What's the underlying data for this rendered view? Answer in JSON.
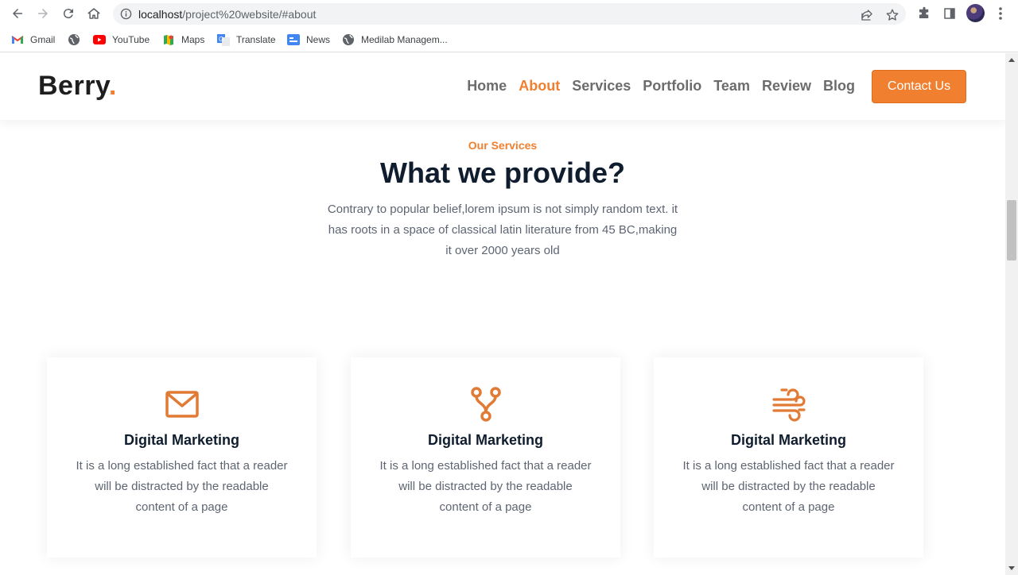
{
  "browser": {
    "url_host": "localhost",
    "url_path": "/project%20website/#about",
    "bookmarks": [
      {
        "label": "Gmail",
        "icon": "gmail-icon"
      },
      {
        "label": "",
        "icon": "globe-icon"
      },
      {
        "label": "YouTube",
        "icon": "youtube-icon"
      },
      {
        "label": "Maps",
        "icon": "maps-icon"
      },
      {
        "label": "Translate",
        "icon": "translate-icon"
      },
      {
        "label": "News",
        "icon": "news-icon"
      },
      {
        "label": "Medilab Managem...",
        "icon": "globe-icon"
      }
    ]
  },
  "site": {
    "logo_text": "Berry",
    "logo_dot": ".",
    "nav": [
      {
        "label": "Home",
        "active": false
      },
      {
        "label": "About",
        "active": true
      },
      {
        "label": "Services",
        "active": false
      },
      {
        "label": "Portfolio",
        "active": false
      },
      {
        "label": "Team",
        "active": false
      },
      {
        "label": "Review",
        "active": false
      },
      {
        "label": "Blog",
        "active": false
      }
    ],
    "contact_label": "Contact Us",
    "accent": "#f07f2f"
  },
  "services": {
    "eyebrow": "Our Services",
    "title": "What we provide?",
    "text": "Contrary to popular belief,lorem ipsum is not simply random text. it has roots in a space of classical latin literature from 45 BC,making it over 2000 years old",
    "cards": [
      {
        "icon": "envelope-icon",
        "title": "Digital Marketing",
        "text": "It is a long established fact that a reader will be distracted by the readable content of a page"
      },
      {
        "icon": "branch-icon",
        "title": "Digital Marketing",
        "text": "It is a long established fact that a reader will be distracted by the readable content of a page"
      },
      {
        "icon": "wind-icon",
        "title": "Digital Marketing",
        "text": "It is a long established fact that a reader will be distracted by the readable content of a page"
      }
    ]
  }
}
